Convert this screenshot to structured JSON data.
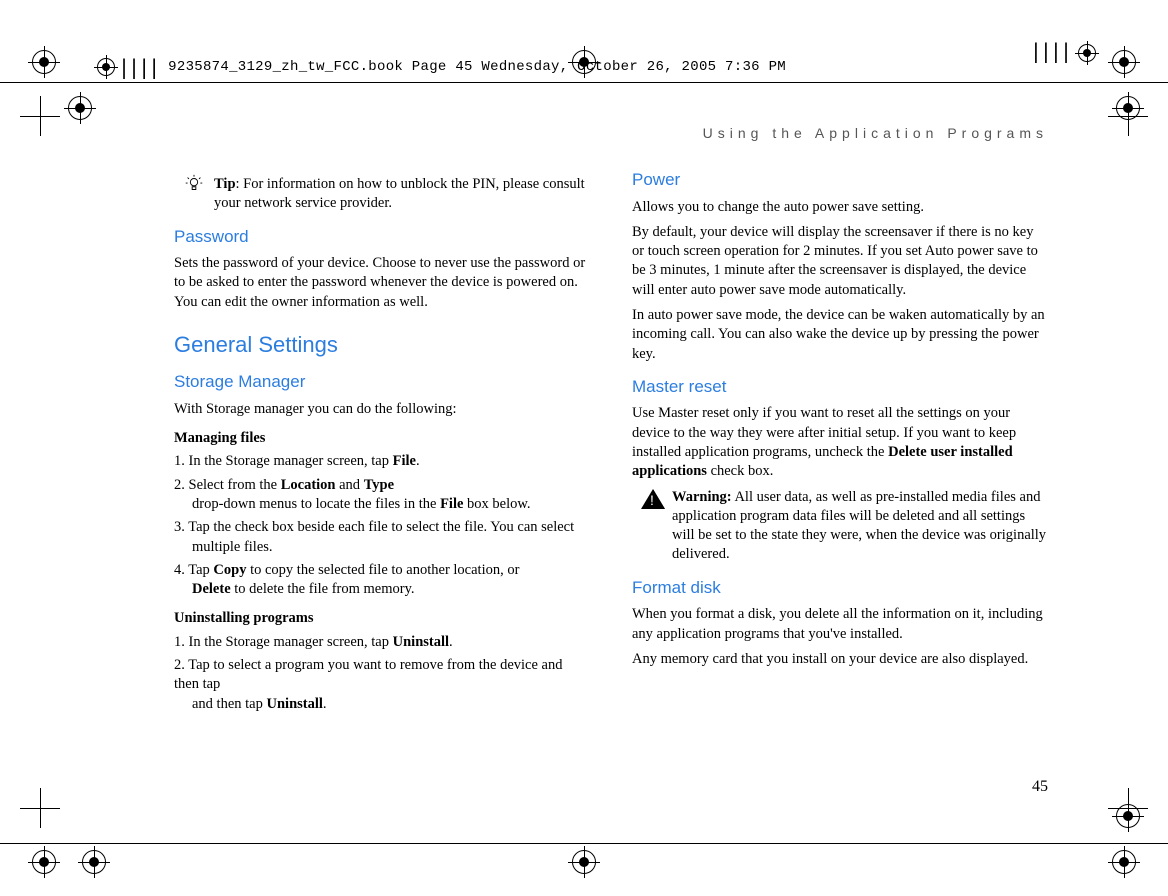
{
  "print_header": "9235874_3129_zh_tw_FCC.book  Page 45  Wednesday, October 26, 2005  7:36 PM",
  "running_head": "Using the Application Programs",
  "tip_label": "Tip",
  "tip_text": ": For information on how to unblock the PIN, please consult your network service provider.",
  "password_h": "Password",
  "password_p": "Sets the password of your device. Choose to never use the password or to be asked to enter the password whenever the device is powered on. You can edit the owner information as well.",
  "general_h": "General Settings",
  "storage_h": "Storage Manager",
  "storage_p": "With Storage manager you can do the following:",
  "managing_h": "Managing files",
  "managing": {
    "s1a": "1. In the Storage manager screen, tap ",
    "s1b": "File",
    "s1c": ".",
    "s2a": "2. Select from the ",
    "s2b": "Location",
    "s2c": " and ",
    "s2d": "Type",
    "s2e": " drop-down menus to locate the files in the ",
    "s2f": "File",
    "s2g": " box below.",
    "s3": "3. Tap the check box beside each file to select the file. You can select multiple files.",
    "s4a": "4. Tap ",
    "s4b": "Copy",
    "s4c": " to copy the selected file to another location, or ",
    "s4d": "Delete",
    "s4e": " to delete the file from memory."
  },
  "uninstall_h": "Uninstalling programs",
  "uninstall": {
    "s1a": "1. In the Storage manager screen, tap ",
    "s1b": "Uninstall",
    "s1c": ".",
    "s2a": "2. Tap to select a program you want to remove from the device and then tap ",
    "s2b": "Uninstall",
    "s2c": "."
  },
  "power_h": "Power",
  "power_p1": "Allows you to change the auto power save setting.",
  "power_p2": "By default, your device will display the screensaver if there is no key or touch screen operation for 2 minutes. If you set Auto power save to be 3 minutes, 1 minute after the screensaver is displayed, the device will enter auto power save mode automatically.",
  "power_p3": "In auto power save mode, the device can be waken automatically by an incoming call. You can also wake the device up by pressing the power key.",
  "master_h": "Master reset",
  "master_p_a": "Use Master reset only if you want to reset all the settings on your device to the way they were after initial setup. If you want to keep installed application programs, uncheck the ",
  "master_p_b": "Delete user installed applications",
  "master_p_c": " check box.",
  "warn_label": "Warning:",
  "warn_text": " All user data, as well as pre-installed media files and application program data files will be deleted and all settings will be set to the state they were, when the device was originally delivered.",
  "format_h": "Format disk",
  "format_p1": "When you format a disk, you delete all the information on it, including any application programs that you've installed.",
  "format_p2": "Any memory card that you install on your device are also displayed.",
  "page_no": "45"
}
